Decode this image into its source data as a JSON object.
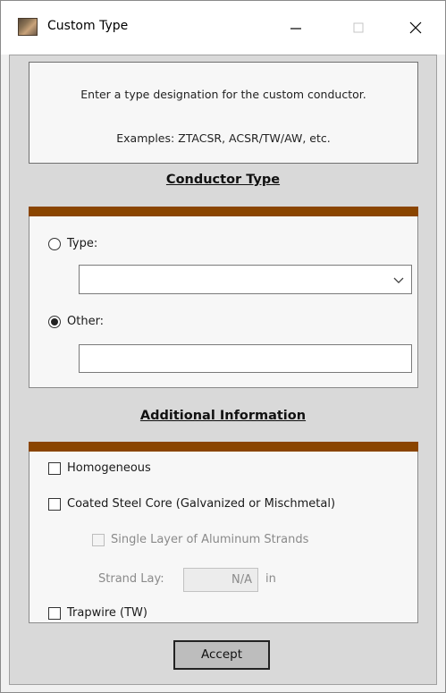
{
  "window": {
    "title": "Custom Type"
  },
  "info": {
    "line1": "Enter a type designation for the custom conductor.",
    "line2": "Examples: ZTACSR, ACSR/TW/AW, etc."
  },
  "conductor_type": {
    "heading": "Conductor Type",
    "type_label": "Type:",
    "type_selected": "",
    "other_label": "Other:",
    "other_value": "",
    "selected": "other"
  },
  "additional": {
    "heading": "Additional Information",
    "homogeneous_label": "Homogeneous",
    "homogeneous_checked": false,
    "coated_label": "Coated Steel Core (Galvanized or Mischmetal)",
    "coated_checked": false,
    "single_layer_label": "Single Layer of Aluminum Strands",
    "single_layer_checked": false,
    "strand_lay_label": "Strand Lay:",
    "strand_lay_value": "N/A",
    "strand_lay_unit": "in",
    "trapwire_label": "Trapwire (TW)",
    "trapwire_checked": false
  },
  "accept_label": "Accept",
  "colors": {
    "section_bar": "#8a4500",
    "body_bg": "#d9d9d9",
    "panel_bg": "#f7f7f7"
  },
  "icons": {
    "app": "app-icon",
    "minimize": "minimize-icon",
    "maximize": "maximize-icon",
    "close": "close-icon",
    "dropdown": "chevron-down-icon"
  }
}
